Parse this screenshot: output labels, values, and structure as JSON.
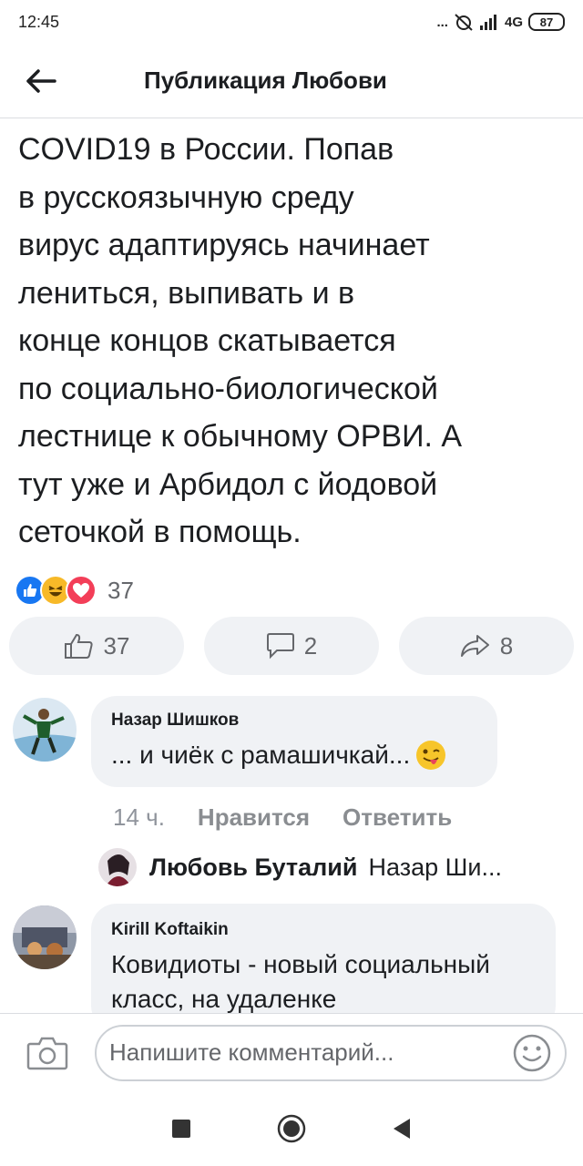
{
  "status_bar": {
    "time": "12:45",
    "dots": "...",
    "network": "4G",
    "battery": "87"
  },
  "header": {
    "title": "Публикация Любови"
  },
  "post": {
    "text": "COVID19 в России. Попав\nв русскоязычную среду\nвирус адаптируясь начинает\nлениться, выпивать и в\nконце концов скатывается\nпо социально-биологической\nлестнице к обычному ОРВИ. А\nтут уже и Арбидол с йодовой\nсеточкой в помощь.",
    "reaction_count": "37"
  },
  "actions": {
    "like_count": "37",
    "comment_count": "2",
    "share_count": "8"
  },
  "comments": [
    {
      "author": "Назар Шишков",
      "text": "... и чиёк с рамашичкай...",
      "time": "14 ч.",
      "like_label": "Нравится",
      "reply_label": "Ответить"
    },
    {
      "author": "Kirill Koftaikin",
      "text": "Ковидиоты - новый социальный класс, на удаленке"
    }
  ],
  "reply_preview": {
    "author": "Любовь Буталий",
    "text": "Назар Ши...",
    "ellipsis": "..."
  },
  "composer": {
    "placeholder": "Напишите комментарий..."
  },
  "colors": {
    "accent": "#1877f2",
    "bubble": "#f0f2f5",
    "muted": "#65676b"
  }
}
